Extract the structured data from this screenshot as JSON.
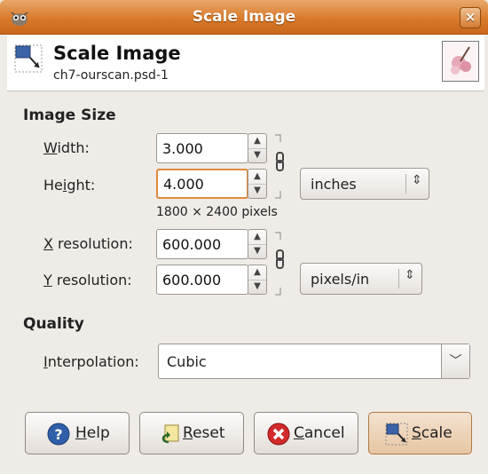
{
  "window": {
    "title": "Scale Image",
    "close_label": "×"
  },
  "header": {
    "title": "Scale Image",
    "subtitle": "ch7-ourscan.psd-1"
  },
  "image_size": {
    "section_title": "Image Size",
    "width": {
      "label_u": "W",
      "label_rest": "idth:",
      "value": "3.000"
    },
    "height": {
      "label_pre": "He",
      "label_u": "i",
      "label_rest": "ght:",
      "value": "4.000"
    },
    "unit": "inches",
    "pixels_text": "1800 × 2400 pixels",
    "x_res": {
      "label_u": "X",
      "label_rest": " resolution:",
      "value": "600.000"
    },
    "y_res": {
      "label_u": "Y",
      "label_rest": " resolution:",
      "value": "600.000"
    },
    "res_unit": "pixels/in"
  },
  "quality": {
    "section_title": "Quality",
    "interp_label_u": "I",
    "interp_label_rest": "nterpolation:",
    "interp_value": "Cubic"
  },
  "buttons": {
    "help": {
      "u": "H",
      "rest": "elp"
    },
    "reset": {
      "u": "R",
      "rest": "eset"
    },
    "cancel": {
      "u": "C",
      "rest": "ancel"
    },
    "scale": {
      "u": "S",
      "rest": "cale"
    }
  }
}
